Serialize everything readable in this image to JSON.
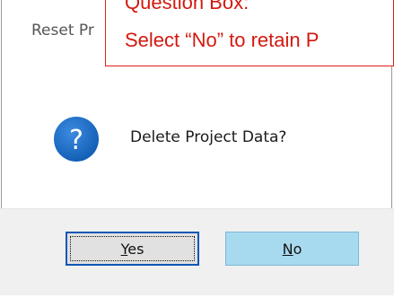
{
  "dialog": {
    "title": "Reset Pr",
    "message": "Delete Project Data?",
    "icon": "question-icon",
    "buttons": {
      "yes": {
        "prefix": "",
        "mnemonic": "Y",
        "suffix": "es"
      },
      "no": {
        "prefix": "",
        "mnemonic": "N",
        "suffix": "o"
      }
    }
  },
  "callout": {
    "line1": "Question Box:",
    "line2": "Select “No” to retain P"
  },
  "colors": {
    "accent": "#0b58b6",
    "no_button_bg": "#a8daef",
    "callout_red": "#d3190f",
    "icon_blue": "#1668c1"
  }
}
